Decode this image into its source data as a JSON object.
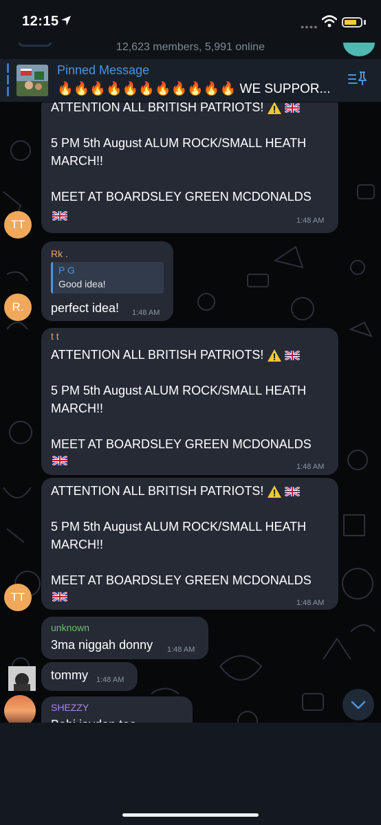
{
  "status_bar": {
    "time": "12:15"
  },
  "header": {
    "subtitle": "12,623 members, 5,991 online"
  },
  "pinned": {
    "title": "Pinned Message",
    "text": "🔥🔥🔥🔥🔥🔥🔥🔥🔥🔥🔥 WE SUPPOR..."
  },
  "messages": [
    {
      "lines": [
        "ATTENTION ALL BRITISH PATRIOTS!",
        "5 PM 5th August ALUM ROCK/SMALL HEATH",
        "MARCH!!",
        "MEET AT BOARDSLEY GREEN MCDONALDS"
      ],
      "time": "1:48 AM",
      "avatar": "TT"
    },
    {
      "sender": "Rk .",
      "reply": {
        "name": "P G",
        "text": "Good idea!"
      },
      "text": "perfect idea!",
      "time": "1:48 AM",
      "avatar": "R."
    },
    {
      "sender": "t t",
      "lines": [
        "ATTENTION ALL BRITISH PATRIOTS!",
        "5 PM 5th August ALUM ROCK/SMALL HEATH",
        "MARCH!!",
        "MEET AT BOARDSLEY GREEN MCDONALDS"
      ],
      "time": "1:48 AM"
    },
    {
      "lines": [
        "ATTENTION ALL BRITISH PATRIOTS!",
        "5 PM 5th August ALUM ROCK/SMALL HEATH",
        "MARCH!!",
        "MEET AT BOARDSLEY GREEN MCDONALDS"
      ],
      "time": "1:48 AM",
      "avatar": "TT"
    },
    {
      "sender": "unknown",
      "text": "3ma niggah donny",
      "time": "1:48 AM"
    },
    {
      "text": "tommy",
      "time": "1:48 AM"
    },
    {
      "sender": "SHEZZY",
      "text": "Babi jaydon too"
    }
  ],
  "colors": {
    "avatar_orange": "#f0a85b",
    "sender_rk": "#f0a35e",
    "sender_unknown": "#6dc06b",
    "sender_shezzy": "#b085e8",
    "accent_blue": "#4a95e0"
  },
  "icons": [
    "location-arrow-icon",
    "wifi-icon",
    "battery-icon",
    "pin-list-icon",
    "warning-icon",
    "union-flag-icon",
    "chevron-down-icon"
  ]
}
